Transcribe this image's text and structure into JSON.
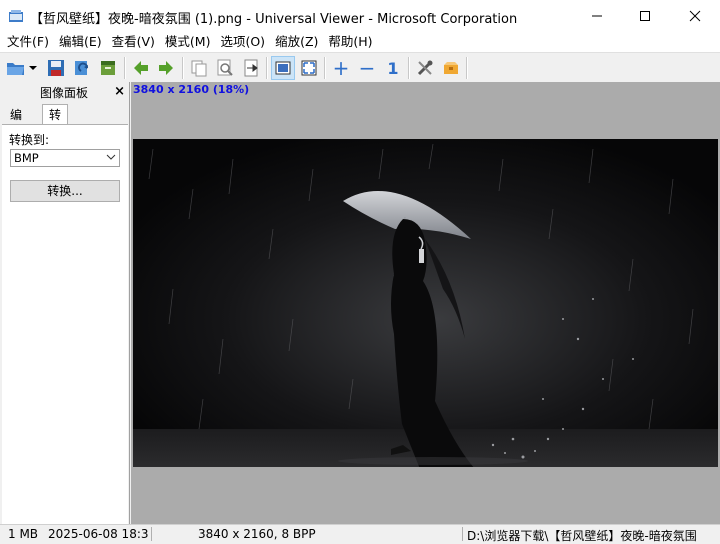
{
  "window": {
    "title": "【哲风壁纸】夜晚-暗夜氛围 (1).png - Universal Viewer - Microsoft Corporation"
  },
  "menu": [
    {
      "label": "文件(F)"
    },
    {
      "label": "编辑(E)"
    },
    {
      "label": "查看(V)"
    },
    {
      "label": "模式(M)"
    },
    {
      "label": "选项(O)"
    },
    {
      "label": "缩放(Z)"
    },
    {
      "label": "帮助(H)"
    }
  ],
  "toolbar": {
    "icons": [
      "open-folder-icon",
      "save-icon",
      "reload-icon",
      "archive-icon",
      "prev-arrow-icon",
      "next-arrow-icon",
      "copy-icon",
      "preview-icon",
      "export-icon",
      "fit-window-icon",
      "fullscreen-icon",
      "zoom-in-icon",
      "zoom-out-icon",
      "actual-size-icon",
      "tools-icon",
      "plugin-icon"
    ],
    "actual_size_label": "1",
    "zoom_in_label": "+",
    "zoom_out_label": "−"
  },
  "panel": {
    "title": "图像面板",
    "close_label": "×",
    "tabs": [
      {
        "label": "编辑"
      },
      {
        "label": "转换"
      }
    ],
    "convert_to_label": "转换到:",
    "format_value": "BMP",
    "convert_button": "转换..."
  },
  "viewer": {
    "info": "3840 x 2160 (18%)"
  },
  "status": {
    "size": "1 MB",
    "datetime": "2025-06-08 18:3",
    "dimensions": "3840 x 2160, 8 BPP",
    "path": "D:\\浏览器下载\\【哲风壁纸】夜晚-暗夜氛围"
  },
  "colors": {
    "accent": "#1010e0",
    "toolbar_active": "#cce4f7",
    "viewer_bg": "#ababab",
    "photo_bg": "#0d0d0e"
  }
}
